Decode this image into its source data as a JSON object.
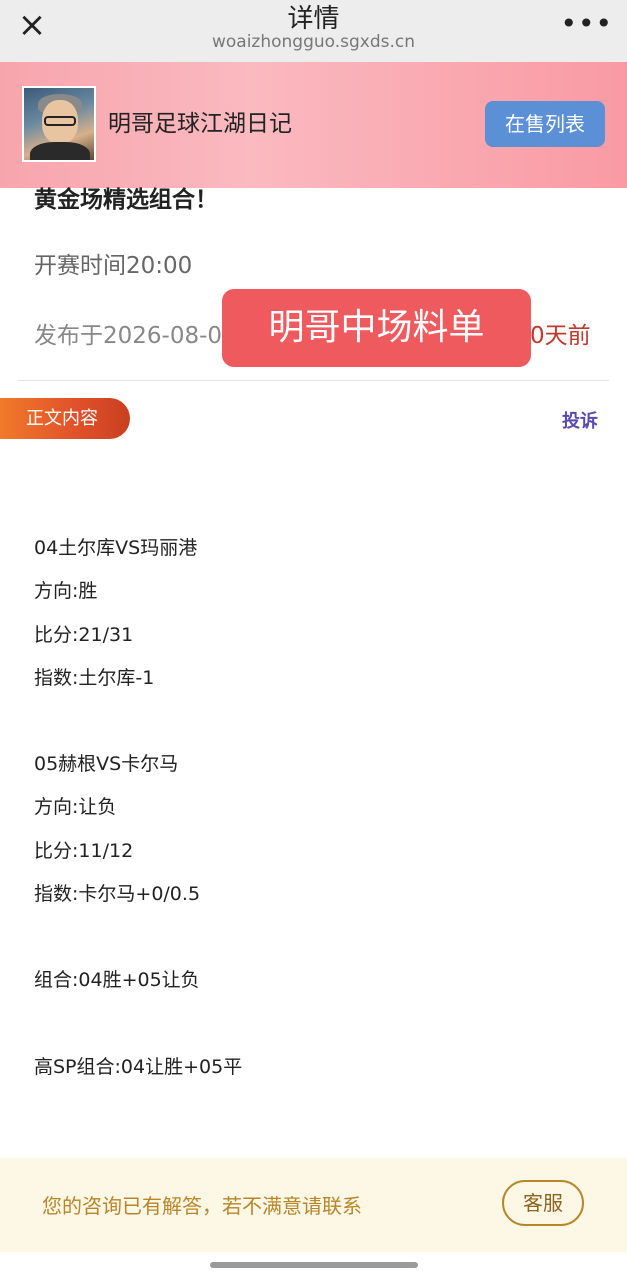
{
  "nav": {
    "close_icon": "×",
    "title": "详情",
    "url": "woaizhongguo.sgxds.cn",
    "more_icon": "•••"
  },
  "banner": {
    "author": "明哥足球江湖日记",
    "sale_button": "在售列表",
    "avatar_icon": "user-avatar"
  },
  "post": {
    "title": "黄金场精选组合！",
    "start_time": "开赛时间20:00",
    "publish_prefix": "发布于2026-08-0",
    "days_ago": "0天前",
    "overlay": "明哥中场料单"
  },
  "content": {
    "tag": "正文内容",
    "report": "投诉",
    "lines": [
      "04土尔库VS玛丽港",
      "方向:胜",
      "比分:21/31",
      "指数:土尔库-1",
      "05赫根VS卡尔马",
      "方向:让负",
      "比分:11/12",
      "指数:卡尔马+0/0.5",
      "组合:04胜+05让负",
      "高SP组合:04让胜+05平"
    ]
  },
  "footer": {
    "text": "您的咨询已有解答，若不满意请联系",
    "service_button": "客服"
  }
}
